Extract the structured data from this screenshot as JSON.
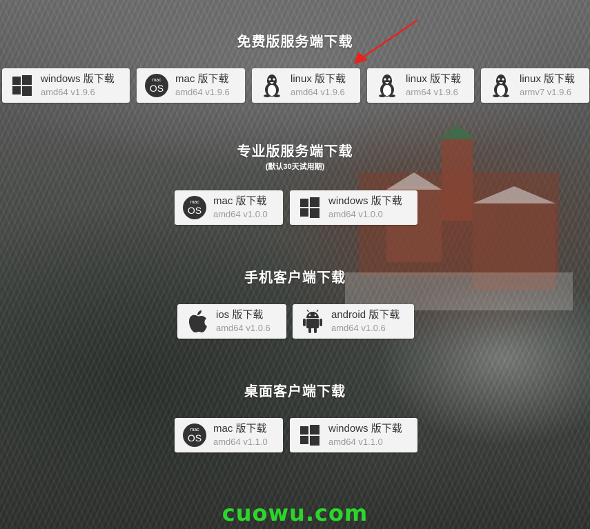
{
  "sections": [
    {
      "title": "免费版服务端下载",
      "buttons": [
        {
          "label": "windows 版下载",
          "version": "amd64 v1.9.6",
          "icon": "windows-icon"
        },
        {
          "label": "mac 版下载",
          "version": "amd64 v1.9.6",
          "icon": "macos-icon"
        },
        {
          "label": "linux 版下载",
          "version": "amd64 v1.9.6",
          "icon": "linux-icon"
        },
        {
          "label": "linux 版下载",
          "version": "arm64 v1.9.6",
          "icon": "linux-icon"
        },
        {
          "label": "linux 版下载",
          "version": "armv7 v1.9.6",
          "icon": "linux-icon"
        }
      ]
    },
    {
      "title": "专业版服务端下载",
      "subtitle": "(默认30天试用期)",
      "buttons": [
        {
          "label": "mac 版下载",
          "version": "amd64 v1.0.0",
          "icon": "macos-icon"
        },
        {
          "label": "windows 版下载",
          "version": "amd64 v1.0.0",
          "icon": "windows-icon"
        }
      ]
    },
    {
      "title": "手机客户端下载",
      "buttons": [
        {
          "label": "ios 版下载",
          "version": "amd64 v1.0.6",
          "icon": "apple-icon"
        },
        {
          "label": "android 版下载",
          "version": "amd64 v1.0.6",
          "icon": "android-icon"
        }
      ]
    },
    {
      "title": "桌面客户端下载",
      "buttons": [
        {
          "label": "mac 版下载",
          "version": "amd64 v1.1.0",
          "icon": "macos-icon"
        },
        {
          "label": "windows 版下载",
          "version": "amd64 v1.1.0",
          "icon": "windows-icon"
        }
      ]
    }
  ],
  "macos_badge": {
    "top": "mac",
    "bottom": "OS"
  },
  "watermark": "cuowu.com",
  "colors": {
    "button_bg": "#f3f3f3",
    "label": "#333333",
    "version": "#9a9a9a",
    "title": "#ffffff",
    "watermark": "#2bd62b",
    "annotation_arrow": "#e8231b"
  }
}
